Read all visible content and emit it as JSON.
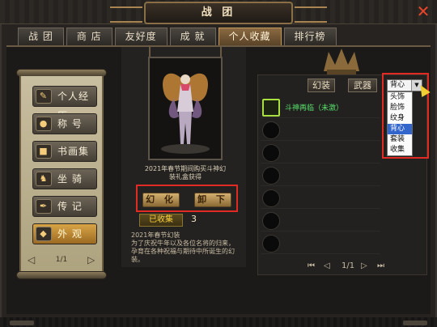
{
  "window": {
    "title": "战 团",
    "close_label": "✕"
  },
  "tabs": [
    "战 团",
    "商 店",
    "友好度",
    "成 就",
    "个人收藏",
    "排行榜"
  ],
  "active_tab_index": 4,
  "left_menu": {
    "items": [
      {
        "label": "个人经历",
        "icon": "scroll-icon"
      },
      {
        "label": "称 号",
        "icon": "coin-icon"
      },
      {
        "label": "书画集",
        "icon": "book-icon"
      },
      {
        "label": "坐 骑",
        "icon": "horse-icon"
      },
      {
        "label": "传 记",
        "icon": "quill-icon"
      },
      {
        "label": "外 观",
        "icon": "armor-icon"
      }
    ],
    "active_index": 5,
    "pager": "1/1"
  },
  "item_detail": {
    "caption": "2021年春节期间购买斗神幻装礼盒获得",
    "buttons": {
      "transform": "幻 化",
      "unload": "卸 下"
    },
    "collected_label": "已收集",
    "collected_count": "3",
    "description": "2021年春节幻装\n为了庆祝牛年以及各位名将的归来，孕育在各种祝福与期待中所诞生的幻装。"
  },
  "filters": {
    "fashion": "幻装",
    "weapon": "武器"
  },
  "dropdown": {
    "selected": "背心",
    "arrow": "▼",
    "options": [
      "头饰",
      "脸饰",
      "纹身",
      "背心",
      "套装",
      "收集"
    ],
    "selected_index": 3
  },
  "collection_list": [
    {
      "label": "斗神再临（未激）",
      "filled": true
    },
    {
      "label": "",
      "filled": false
    },
    {
      "label": "",
      "filled": false
    },
    {
      "label": "",
      "filled": false
    },
    {
      "label": "",
      "filled": false
    },
    {
      "label": "",
      "filled": false
    },
    {
      "label": "",
      "filled": false
    },
    {
      "label": "",
      "filled": false
    }
  ],
  "right_pager": {
    "text": "1/1"
  },
  "colors": {
    "accent_red": "#e02a22",
    "gold": "#d8a446",
    "list_green": "#58e06a"
  }
}
